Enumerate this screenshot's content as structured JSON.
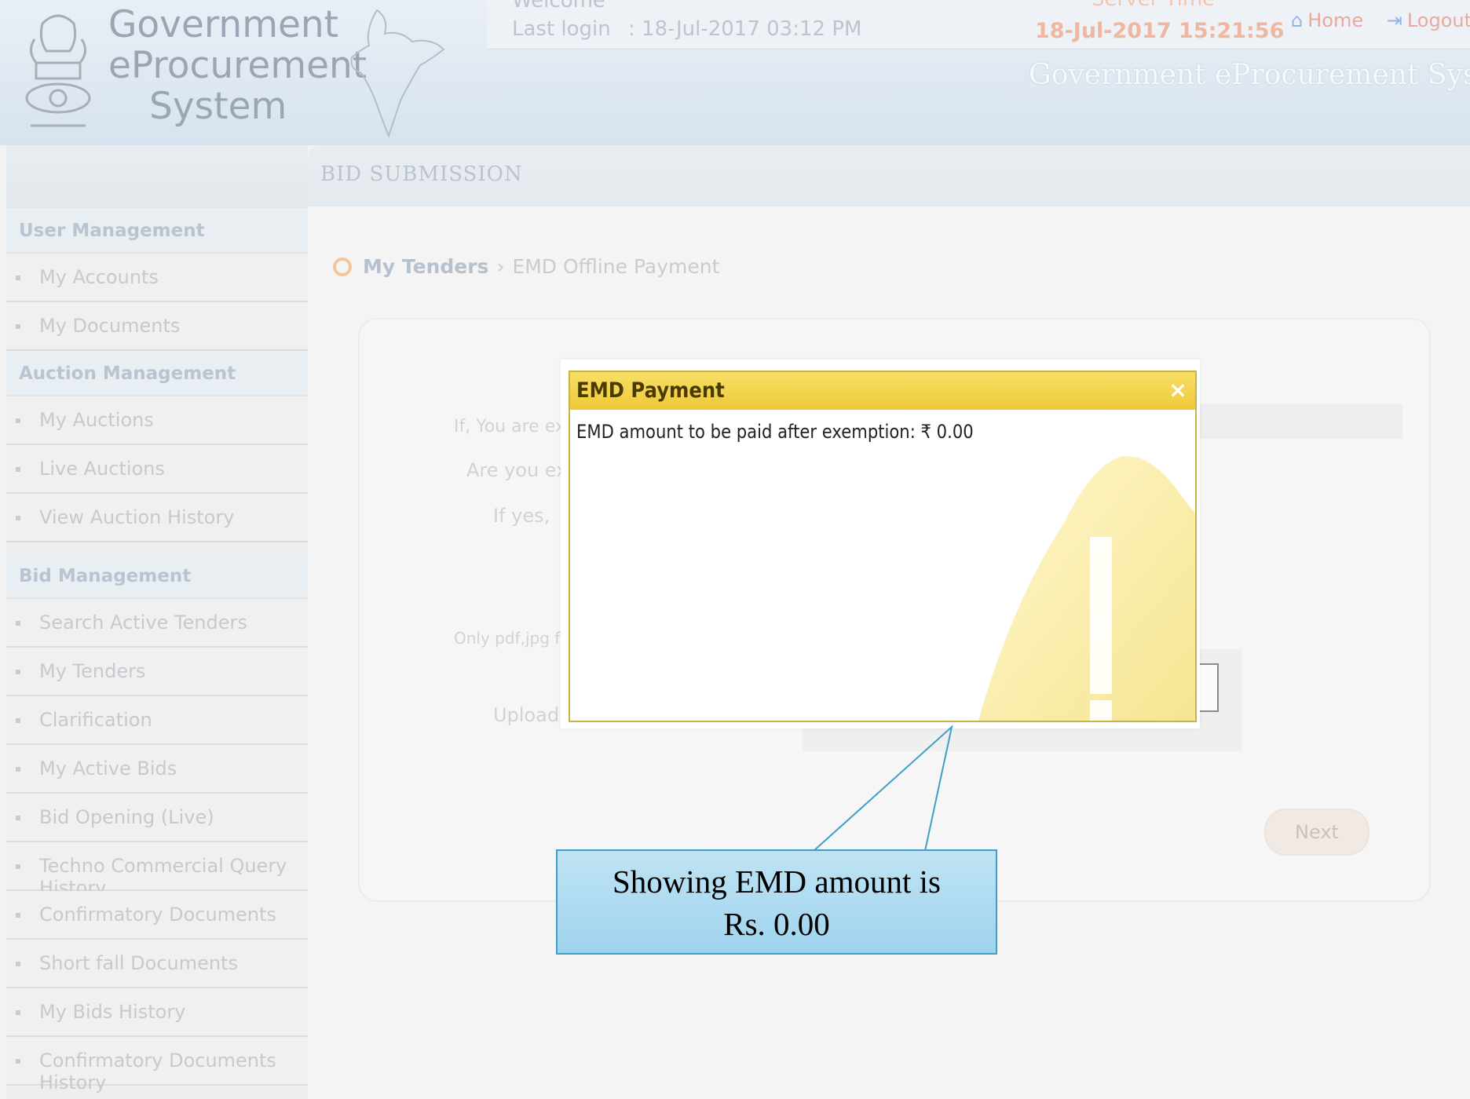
{
  "header": {
    "logo_lines": [
      "Government",
      "eProcurement",
      "System"
    ],
    "welcome_label": "Welcome",
    "last_login_label": "Last login",
    "last_login_value": ": 18-Jul-2017 03:12 PM",
    "server_time_label": "Server Time",
    "server_time": "18-Jul-2017 15:21:56",
    "home_label": "Home",
    "logout_label": "Logout",
    "system_name": "Government eProcurement System"
  },
  "sidebar": {
    "sections": [
      {
        "heading": "User Management",
        "items": [
          "My Accounts",
          "My Documents"
        ]
      },
      {
        "heading": "Auction Management",
        "items": [
          "My Auctions",
          "Live Auctions",
          "View Auction History"
        ]
      },
      {
        "heading": "Bid Management",
        "items": [
          "Search Active Tenders",
          "My Tenders",
          "Clarification",
          "My Active Bids",
          "Bid Opening (Live)",
          "Techno Commercial Query History",
          "Confirmatory Documents",
          "Short fall Documents",
          "My Bids History",
          "Confirmatory Documents History"
        ]
      }
    ]
  },
  "main": {
    "title": "BID SUBMISSION",
    "breadcrumb": {
      "home": "My Tenders",
      "separator": "›",
      "current": "EMD Offline Payment"
    },
    "faded_texts": [
      "If, You are ex",
      "Are you ex",
      "If yes,",
      "Only pdf,jpg f",
      "Upload"
    ],
    "next_label": "Next"
  },
  "dialog": {
    "title": "EMD Payment",
    "close_label": "×",
    "message": "EMD amount to be paid after exemption: ₹ 0.00"
  },
  "callout": {
    "line1": "Showing EMD amount is",
    "line2": "Rs. 0.00"
  },
  "colors": {
    "dialog_title": "#eec93a",
    "callout_fill": "#a8d8f0",
    "callout_border": "#3e9ec7"
  }
}
